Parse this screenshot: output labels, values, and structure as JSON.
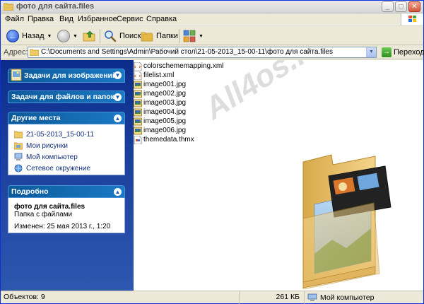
{
  "window": {
    "title": "фото для сайта.files",
    "buttons": {
      "minimize": "_",
      "maximize": "□",
      "close": "✕"
    }
  },
  "menubar": {
    "items": [
      "Файл",
      "Правка",
      "Вид",
      "Избранное",
      "Сервис",
      "Справка"
    ]
  },
  "toolbar": {
    "back_label": "Назад",
    "search_label": "Поиск",
    "folders_label": "Папки"
  },
  "address": {
    "label": "Адрес:",
    "path": "C:\\Documents and Settings\\Admin\\Рабочий стол\\21-05-2013_15-00-11\\фото для сайта.files",
    "go_label": "Переход"
  },
  "taskpane": {
    "image_tasks": "Задачи для изображений",
    "file_tasks": "Задачи для файлов и папок",
    "other_places": {
      "title": "Другие места",
      "links": [
        {
          "label": "21-05-2013_15-00-11",
          "icon": "folder-icon"
        },
        {
          "label": "Мои рисунки",
          "icon": "pictures-icon"
        },
        {
          "label": "Мой компьютер",
          "icon": "computer-icon"
        },
        {
          "label": "Сетевое окружение",
          "icon": "network-icon"
        }
      ]
    },
    "details": {
      "title": "Подробно",
      "name": "фото для сайта.files",
      "type": "Папка с файлами",
      "modified": "Изменен: 25 мая 2013 г., 1:20"
    }
  },
  "files": [
    {
      "name": "colorschememapping.xml",
      "type": "xml"
    },
    {
      "name": "filelist.xml",
      "type": "xml"
    },
    {
      "name": "image001.jpg",
      "type": "jpg"
    },
    {
      "name": "image002.jpg",
      "type": "jpg"
    },
    {
      "name": "image003.jpg",
      "type": "jpg"
    },
    {
      "name": "image004.jpg",
      "type": "jpg"
    },
    {
      "name": "image005.jpg",
      "type": "jpg"
    },
    {
      "name": "image006.jpg",
      "type": "jpg"
    },
    {
      "name": "themedata.thmx",
      "type": "thmx"
    }
  ],
  "watermark": "All4os.RU",
  "statusbar": {
    "objects": "Объектов: 9",
    "size": "261 КБ",
    "location": "Мой компьютер"
  },
  "colors": {
    "taskpane_top": "#0c2c8c",
    "taskpane_header": "#1b79c4",
    "link": "#15307c"
  }
}
